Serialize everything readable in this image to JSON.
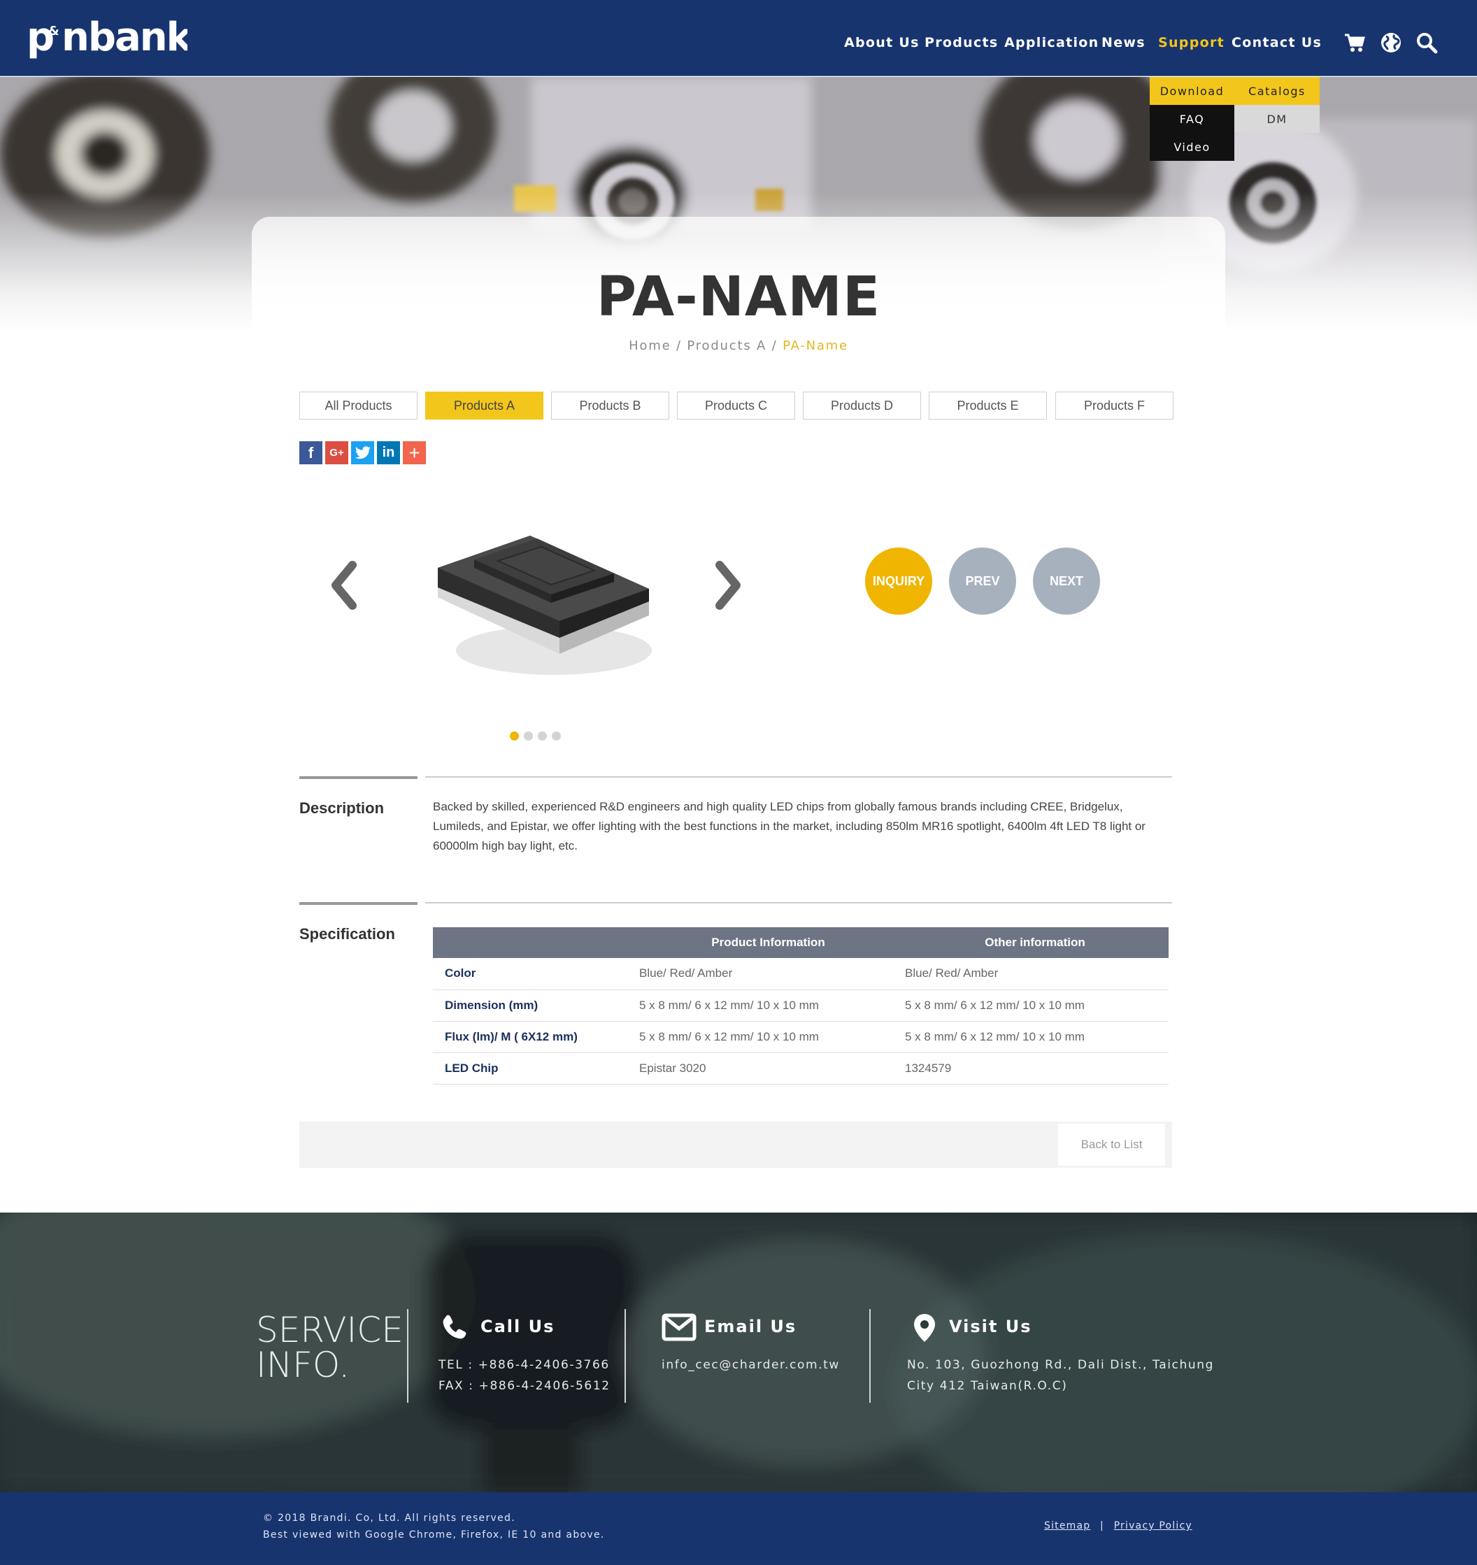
{
  "header": {
    "logo_text": "p&nbank",
    "nav": [
      "About Us",
      "Products",
      "Application",
      "News",
      "Support",
      "Contact Us"
    ],
    "active_nav": "Support",
    "icons": [
      "cart-icon",
      "globe-icon",
      "search-icon"
    ]
  },
  "support_menu": {
    "download": "Download",
    "catalogs": "Catalogs",
    "faq": "FAQ",
    "dm": "DM",
    "video": "Video"
  },
  "page": {
    "title": "PA-NAME",
    "breadcrumb": {
      "home": "Home",
      "sep1": " / ",
      "section": "Products A",
      "sep2": " / ",
      "current": "PA-Name"
    }
  },
  "tabs": [
    "All Products",
    "Products A",
    "Products B",
    "Products C",
    "Products D",
    "Products E",
    "Products F"
  ],
  "active_tab": "Products A",
  "social": {
    "facebook": "f",
    "google": "G+",
    "twitter": "twitter-icon",
    "linkedin": "in",
    "more": "+"
  },
  "gallery": {
    "slides": 4,
    "active": 1
  },
  "actions": {
    "inquiry": "INQUIRY",
    "prev": "PREV",
    "next": "NEXT"
  },
  "description": {
    "heading": "Description",
    "text": "Backed by skilled, experienced R&D engineers and high quality LED chips from globally famous brands including CREE, Bridgelux, Lumileds, and Epistar, we offer lighting with the best functions in the market, including 850lm MR16 spotlight, 6400lm 4ft LED T8 light or 60000lm high bay light, etc."
  },
  "specification": {
    "heading": "Specification",
    "columns": [
      "",
      "Product Information",
      "Other information"
    ],
    "rows": [
      {
        "key": "Color",
        "v1": "Blue/ Red/ Amber",
        "v2": "Blue/ Red/ Amber"
      },
      {
        "key": "Dimension (mm)",
        "v1": "5 x 8 mm/ 6 x 12 mm/ 10 x 10 mm",
        "v2": "5 x 8 mm/ 6 x 12 mm/ 10 x 10 mm"
      },
      {
        "key": "Flux (lm)/ M ( 6X12 mm)",
        "v1": "5 x 8 mm/ 6 x 12 mm/ 10 x 10 mm",
        "v2": "5 x 8 mm/ 6 x 12 mm/ 10 x 10 mm"
      },
      {
        "key": "LED Chip",
        "v1": "Epistar 3020",
        "v2": "1324579"
      }
    ]
  },
  "back_to_list": "Back to List",
  "footer": {
    "service_line1": "SERVICE",
    "service_line2": "INFO.",
    "call": {
      "heading": "Call Us",
      "tel": "TEL : +886-4-2406-3766",
      "fax": "FAX : +886-4-2406-5612"
    },
    "email": {
      "heading": "Email Us",
      "address": "info_cec@charder.com.tw"
    },
    "visit": {
      "heading": "Visit Us",
      "line1": "No. 103, Guozhong Rd., Dali Dist., Taichung",
      "line2": "City 412 Taiwan(R.O.C)"
    },
    "copyright": "© 2018 Brandi. Co, Ltd. All rights reserved.",
    "browsers": "Best viewed with Google Chrome, Firefox, IE 10 and above.",
    "sitemap": "Sitemap",
    "divider": "|",
    "privacy": "Privacy Policy"
  },
  "colors": {
    "brand_navy": "#17346f",
    "accent_yellow": "#f3c61b",
    "inquiry_orange": "#f0b500",
    "muted_button": "#a7b1be",
    "table_header": "#6d7584"
  }
}
